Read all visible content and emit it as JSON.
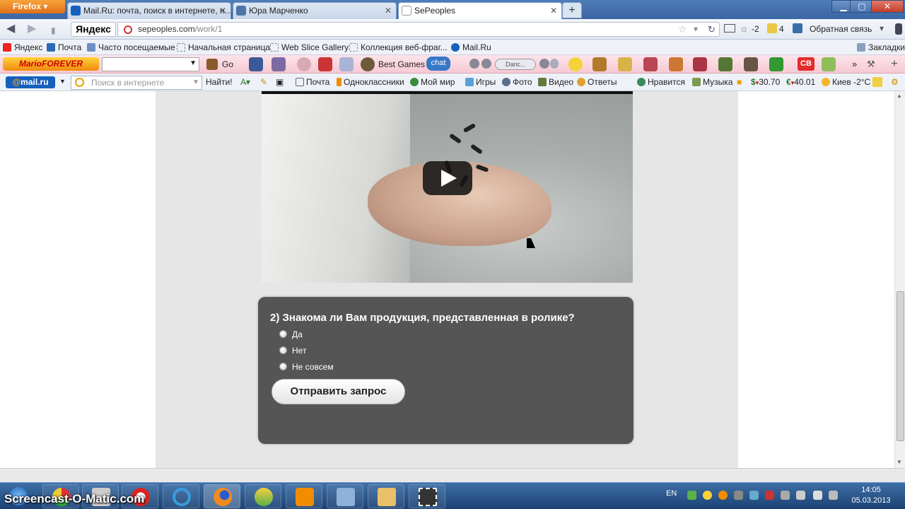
{
  "browser": {
    "app_button": "Firefox",
    "tabs": [
      {
        "title": "Mail.Ru: почта, поиск в интернете, н...",
        "active": false
      },
      {
        "title": "Юра Марченко",
        "active": false
      },
      {
        "title": "SePeoples",
        "active": true
      }
    ],
    "search_engine": "Яндекс",
    "url_host": "sepeoples.com",
    "url_path": "/work/1",
    "weather_temp": "-2",
    "mail_count": "4",
    "feedback_label": "Обратная связь"
  },
  "bookmarks": {
    "items": [
      "Яндекс",
      "Почта",
      "Часто посещаемые",
      "Начальная страница",
      "Web Slice Gallery",
      "Коллекция веб-фраг...",
      "Mail.Ru"
    ],
    "right_label": "Закладки"
  },
  "toolbar1": {
    "logo": "MarioFOREVER",
    "go_label": "Go",
    "best_games": "Best Games",
    "chat_label": "chat",
    "dance_label": "Danc...",
    "cb_label": "CB"
  },
  "toolbar2": {
    "logo_at": "@",
    "logo_text": "mail.ru",
    "search_placeholder": "Поиск в интернете",
    "find_label": "Найти!",
    "items": [
      "Почта",
      "Одноклассники",
      "Мой мир",
      "Игры",
      "Фото",
      "Видео",
      "Ответы",
      "Нравится",
      "Музыка"
    ],
    "usd": "30.70",
    "eur": "40.01",
    "weather": "Киев -2°C"
  },
  "quiz": {
    "question": "2) Знакома ли Вам продукция, представленная в ролике?",
    "options": [
      "Да",
      "Нет",
      "Не совсем"
    ],
    "submit_label": "Отправить запрос"
  },
  "taskbar": {
    "watermark": "Screencast-O-Matic.com",
    "lang": "EN",
    "time": "14:05",
    "date": "05.03.2013"
  }
}
